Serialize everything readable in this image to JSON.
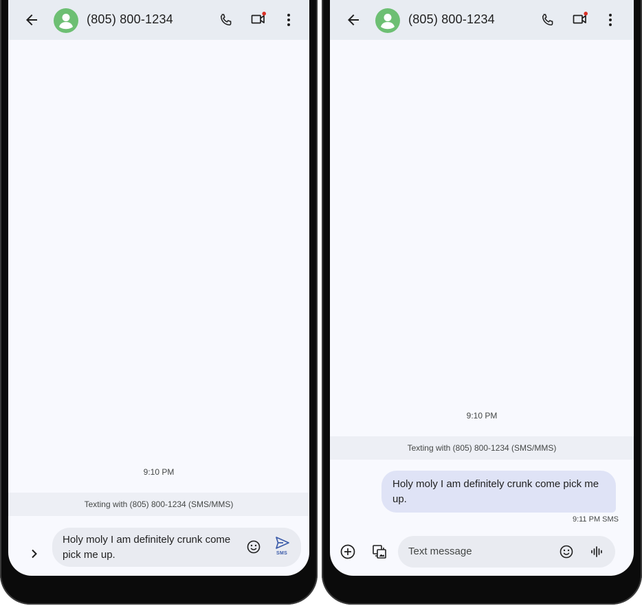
{
  "left": {
    "contact": "(805) 800-1234",
    "time": "9:10 PM",
    "info": "Texting with (805) 800-1234 (SMS/MMS)",
    "draft": "Holy moly I am definitely crunk come pick me up.",
    "send_tag": "SMS"
  },
  "right": {
    "contact": "(805) 800-1234",
    "time": "9:10 PM",
    "info": "Texting with (805) 800-1234 (SMS/MMS)",
    "message": {
      "text": "Holy moly I am definitely crunk come pick me up.",
      "meta": "9:11 PM SMS"
    },
    "compose_placeholder": "Text message"
  },
  "colors": {
    "avatar": "#6dbf73",
    "bubble": "#dfe3f6",
    "notification_dot": "#d93025",
    "accent": "#3b5ba9"
  },
  "icons": [
    "back-arrow-icon",
    "person-icon",
    "phone-icon",
    "video-camera-icon",
    "more-vert-icon",
    "chevron-right-icon",
    "emoji-icon",
    "send-icon",
    "add-circle-icon",
    "gallery-icon",
    "voice-icon"
  ]
}
